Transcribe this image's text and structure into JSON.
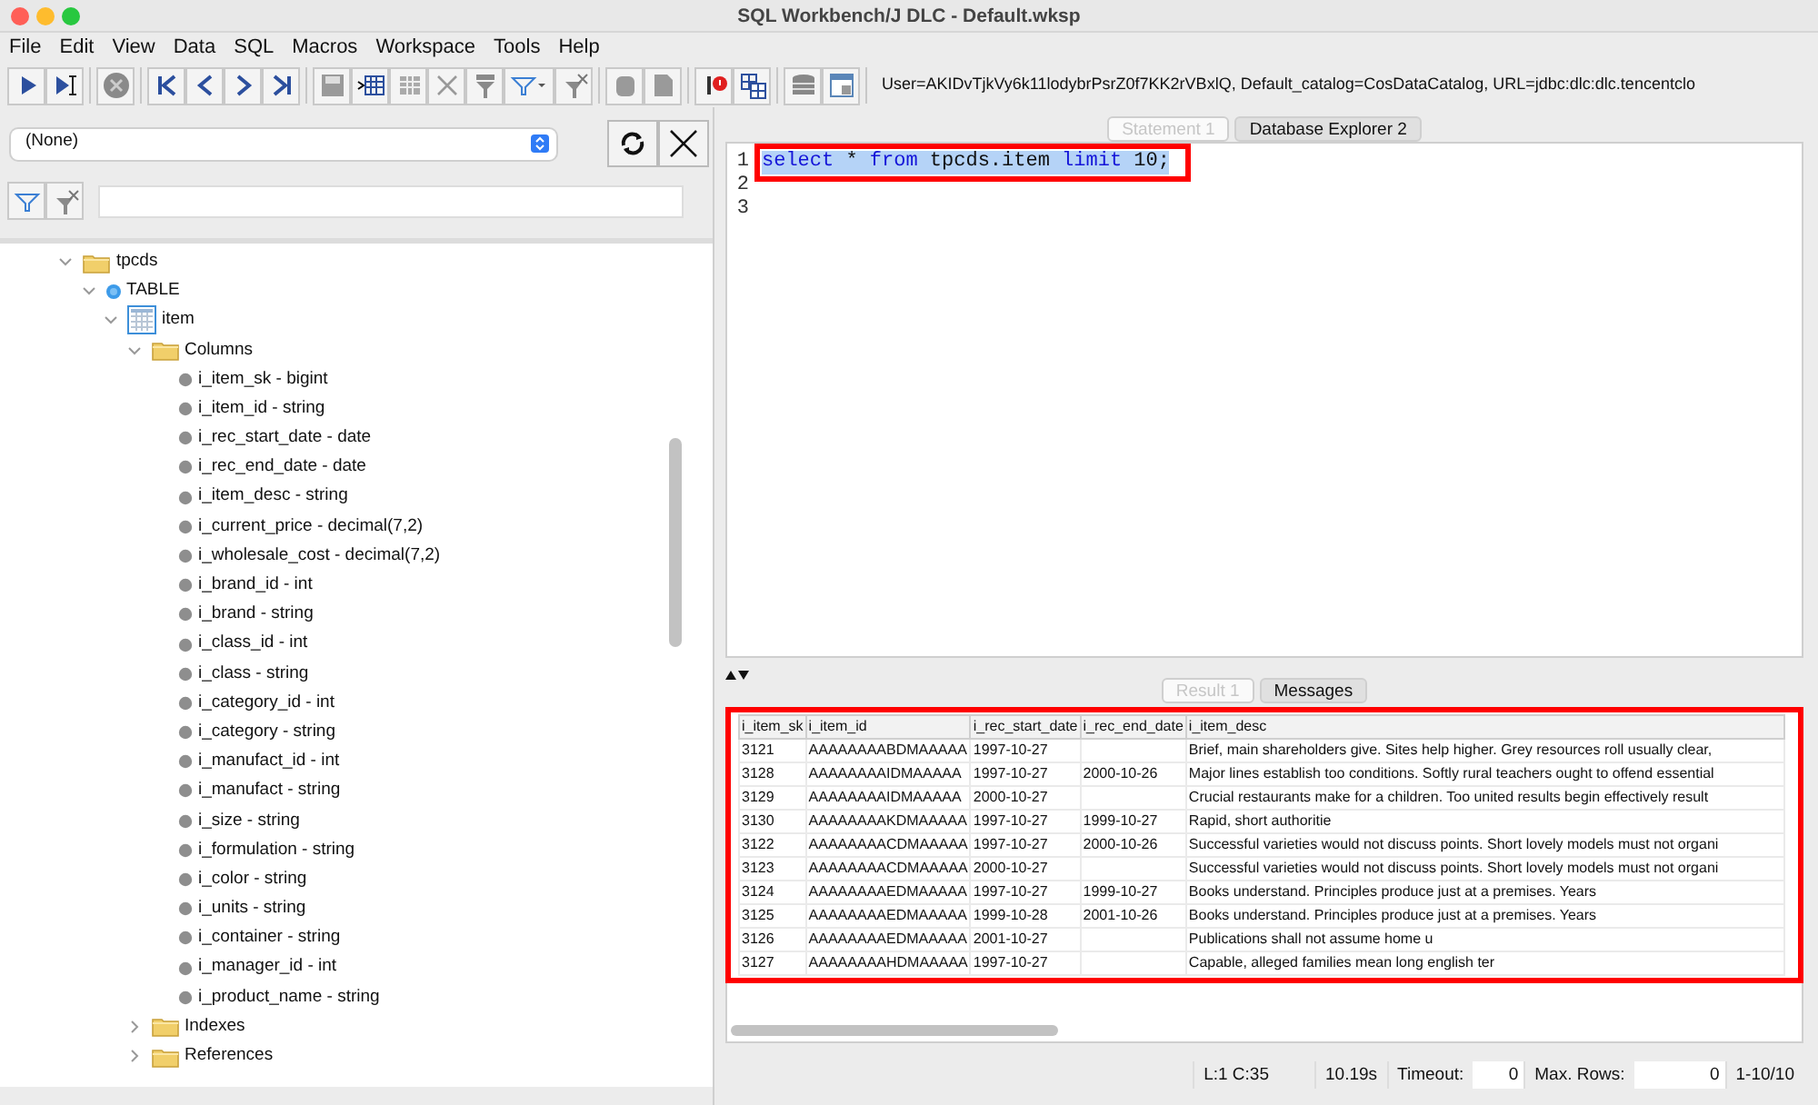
{
  "window": {
    "title": "SQL Workbench/J DLC - Default.wksp"
  },
  "menu": [
    "File",
    "Edit",
    "View",
    "Data",
    "SQL",
    "Macros",
    "Workspace",
    "Tools",
    "Help"
  ],
  "connection_info": "User=AKIDvTjkVy6k11lodybrPsrZ0f7KK2rVBxlQ, Default_catalog=CosDataCatalog, URL=jdbc:dlc:dlc.tencentclo",
  "profile_select": {
    "value": "(None)"
  },
  "tree": [
    {
      "label": "tpcds",
      "kind": "folder",
      "expanded": true,
      "children": [
        {
          "label": "TABLE",
          "kind": "type",
          "expanded": true,
          "children": [
            {
              "label": "item",
              "kind": "table",
              "expanded": true,
              "children": [
                {
                  "label": "Columns",
                  "kind": "folder",
                  "expanded": true,
                  "children": [
                    {
                      "label": "i_item_sk - bigint",
                      "kind": "column"
                    },
                    {
                      "label": "i_item_id - string",
                      "kind": "column"
                    },
                    {
                      "label": "i_rec_start_date - date",
                      "kind": "column"
                    },
                    {
                      "label": "i_rec_end_date - date",
                      "kind": "column"
                    },
                    {
                      "label": "i_item_desc - string",
                      "kind": "column"
                    },
                    {
                      "label": "i_current_price - decimal(7,2)",
                      "kind": "column"
                    },
                    {
                      "label": "i_wholesale_cost - decimal(7,2)",
                      "kind": "column"
                    },
                    {
                      "label": "i_brand_id - int",
                      "kind": "column"
                    },
                    {
                      "label": "i_brand - string",
                      "kind": "column"
                    },
                    {
                      "label": "i_class_id - int",
                      "kind": "column"
                    },
                    {
                      "label": "i_class - string",
                      "kind": "column"
                    },
                    {
                      "label": "i_category_id - int",
                      "kind": "column"
                    },
                    {
                      "label": "i_category - string",
                      "kind": "column"
                    },
                    {
                      "label": "i_manufact_id - int",
                      "kind": "column"
                    },
                    {
                      "label": "i_manufact - string",
                      "kind": "column"
                    },
                    {
                      "label": "i_size - string",
                      "kind": "column"
                    },
                    {
                      "label": "i_formulation - string",
                      "kind": "column"
                    },
                    {
                      "label": "i_color - string",
                      "kind": "column"
                    },
                    {
                      "label": "i_units - string",
                      "kind": "column"
                    },
                    {
                      "label": "i_container - string",
                      "kind": "column"
                    },
                    {
                      "label": "i_manager_id - int",
                      "kind": "column"
                    },
                    {
                      "label": "i_product_name - string",
                      "kind": "column"
                    }
                  ]
                },
                {
                  "label": "Indexes",
                  "kind": "folder",
                  "expanded": false
                },
                {
                  "label": "References",
                  "kind": "folder",
                  "expanded": false
                }
              ]
            }
          ]
        }
      ]
    }
  ],
  "editor_tabs": [
    {
      "label": "Statement 1",
      "selected": true
    },
    {
      "label": "Database Explorer 2",
      "selected": false
    }
  ],
  "editor": {
    "annotated": true,
    "lines": [
      {
        "number": "1",
        "highlighted": true,
        "tokens": [
          {
            "text": "select",
            "kind": "keyword"
          },
          {
            "text": " * ",
            "kind": "plain"
          },
          {
            "text": "from",
            "kind": "keyword"
          },
          {
            "text": " tpcds.item ",
            "kind": "plain"
          },
          {
            "text": "limit",
            "kind": "keyword"
          },
          {
            "text": " 10;",
            "kind": "plain"
          }
        ]
      },
      {
        "number": "2"
      },
      {
        "number": "3"
      }
    ]
  },
  "result_tabs": [
    {
      "label": "Result 1",
      "selected": true
    },
    {
      "label": "Messages",
      "selected": false
    }
  ],
  "table": {
    "annotated": true,
    "columns": [
      "i_item_sk",
      "i_item_id",
      "i_rec_start_date",
      "i_rec_end_date",
      "i_item_desc"
    ],
    "rows": [
      [
        "3121",
        "AAAAAAAABDMAAAAA",
        "1997-10-27",
        null,
        "Brief, main shareholders give. Sites help higher. Grey resources roll usually clear,"
      ],
      [
        "3128",
        "AAAAAAAAIDMAAAAA",
        "1997-10-27",
        "2000-10-26",
        "Major lines establish too conditions. Softly rural teachers ought to offend essential"
      ],
      [
        "3129",
        "AAAAAAAAIDMAAAAA",
        "2000-10-27",
        null,
        "Crucial restaurants make for a children. Too united results begin effectively result"
      ],
      [
        "3130",
        "AAAAAAAAKDMAAAAA",
        "1997-10-27",
        "1999-10-27",
        "Rapid, short authoritie"
      ],
      [
        "3122",
        "AAAAAAAACDMAAAAA",
        "1997-10-27",
        "2000-10-26",
        "Successful varieties would not discuss points. Short lovely models must not organi"
      ],
      [
        "3123",
        "AAAAAAAACDMAAAAA",
        "2000-10-27",
        null,
        "Successful varieties would not discuss points. Short lovely models must not organi"
      ],
      [
        "3124",
        "AAAAAAAAEDMAAAAA",
        "1997-10-27",
        "1999-10-27",
        "Books understand. Principles produce just at a premises. Years"
      ],
      [
        "3125",
        "AAAAAAAAEDMAAAAA",
        "1999-10-28",
        "2001-10-26",
        "Books understand. Principles produce just at a premises. Years"
      ],
      [
        "3126",
        "AAAAAAAAEDMAAAAA",
        "2001-10-27",
        null,
        "Publications shall not assume home u"
      ],
      [
        "3127",
        "AAAAAAAAHDMAAAAA",
        "1997-10-27",
        null,
        "Capable, alleged families mean long english ter"
      ]
    ]
  },
  "status_bar": {
    "position": "L:1 C:35",
    "elapsed": "10.19s",
    "timeout_label": "Timeout:",
    "timeout": "0",
    "max_rows_label": "Max. Rows:",
    "max_rows": "0",
    "row_range": "1-10/10"
  }
}
